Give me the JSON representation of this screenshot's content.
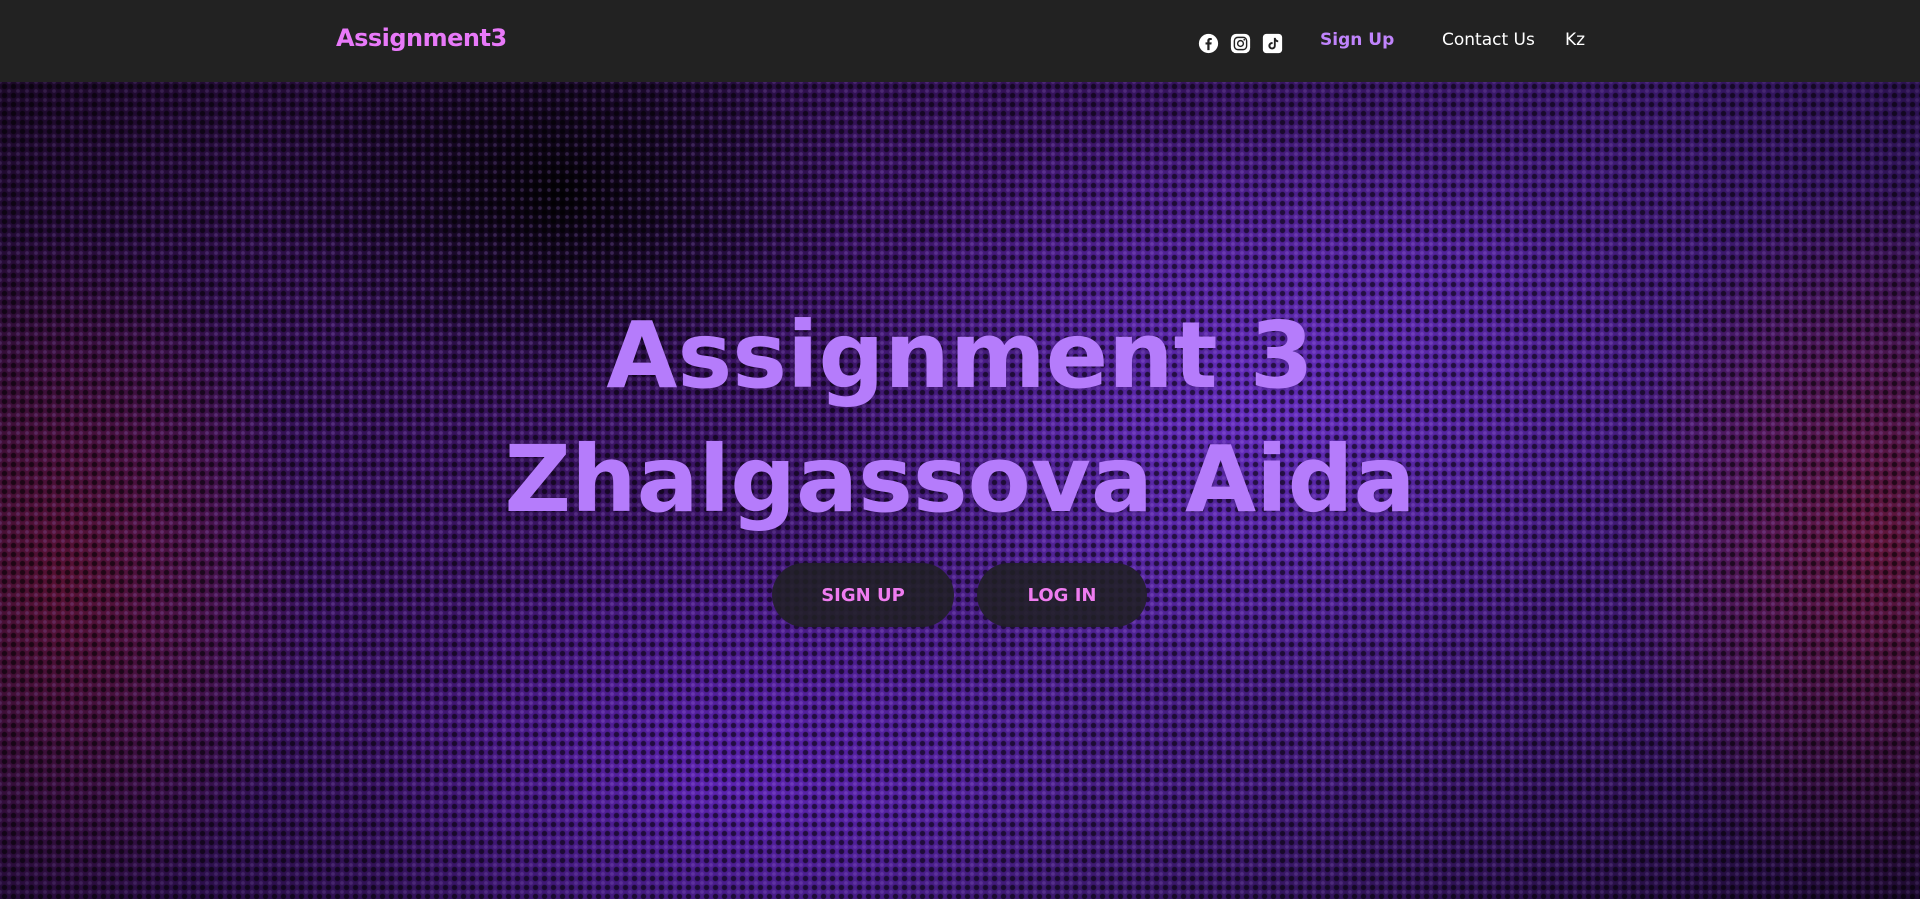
{
  "navbar": {
    "brand": "Assignment3",
    "socials": [
      "facebook-icon",
      "instagram-icon",
      "tiktok-icon"
    ],
    "links": {
      "sign_up": "Sign Up",
      "contact": "Contact Us",
      "language": "Kz"
    }
  },
  "hero": {
    "title_line1": "Assignment 3",
    "title_line2": "Zhalgassova Aida",
    "buttons": {
      "sign_up": "SIGN UP",
      "log_in": "LOG IN"
    }
  },
  "colors": {
    "navbar_bg": "#222222",
    "brand": "#e879f9",
    "nav_accent": "#c084fc",
    "hero_title": "#b57cfb",
    "button_text": "#ef7cf0",
    "button_bg": "#202024"
  }
}
